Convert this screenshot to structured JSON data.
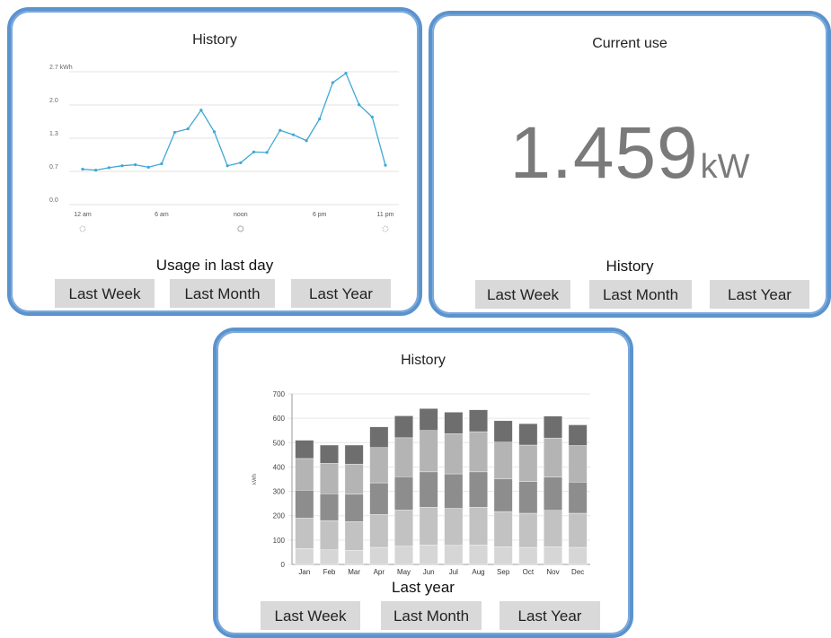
{
  "day_panel": {
    "title": "History",
    "subtitle": "Usage in last day",
    "buttons": [
      "Last Week",
      "Last Month",
      "Last Year"
    ]
  },
  "current_panel": {
    "title": "Current use",
    "value": "1.459",
    "unit": "kW",
    "subtitle": "History",
    "buttons": [
      "Last Week",
      "Last Month",
      "Last Year"
    ]
  },
  "year_panel": {
    "title": "History",
    "subtitle": "Last year",
    "buttons": [
      "Last Week",
      "Last Month",
      "Last Year"
    ]
  },
  "chart_data": [
    {
      "type": "line",
      "title": "History",
      "ylabel": "kWh",
      "yticks": [
        "0.0",
        "0.7",
        "1.3",
        "2.0",
        "2.7 kWh"
      ],
      "ylim": [
        0,
        2.7
      ],
      "xticks": [
        "12 am",
        "6 am",
        "noon",
        "6 pm",
        "11 pm"
      ],
      "xtick_hours": [
        0,
        6,
        12,
        18,
        23
      ],
      "x": [
        0,
        1,
        2,
        3,
        4,
        5,
        6,
        7,
        8,
        9,
        10,
        11,
        12,
        13,
        14,
        15,
        16,
        17,
        18,
        19,
        20,
        21,
        22,
        23
      ],
      "values": [
        0.72,
        0.7,
        0.75,
        0.79,
        0.81,
        0.76,
        0.83,
        1.47,
        1.54,
        1.92,
        1.48,
        0.79,
        0.85,
        1.07,
        1.06,
        1.51,
        1.42,
        1.3,
        1.74,
        2.48,
        2.67,
        2.03,
        1.78,
        0.8
      ],
      "line_color": "#3fa7d6",
      "grid": true
    },
    {
      "type": "bar",
      "stacked": true,
      "title": "History",
      "xlabel": "Last year",
      "ylabel": "kWh",
      "categories": [
        "Jan",
        "Feb",
        "Mar",
        "Apr",
        "May",
        "Jun",
        "Jul",
        "Aug",
        "Sep",
        "Oct",
        "Nov",
        "Dec"
      ],
      "ylim": [
        0,
        700
      ],
      "yticks": [
        0,
        100,
        200,
        300,
        400,
        500,
        600,
        700
      ],
      "series": [
        {
          "values": [
            65,
            60,
            58,
            70,
            75,
            80,
            78,
            80,
            72,
            70,
            72,
            70
          ],
          "color": "#d6d6d6"
        },
        {
          "values": [
            125,
            120,
            118,
            135,
            148,
            155,
            152,
            155,
            145,
            140,
            150,
            140
          ],
          "color": "#c2c2c2"
        },
        {
          "values": [
            115,
            110,
            112,
            130,
            137,
            145,
            142,
            145,
            135,
            130,
            137,
            128
          ],
          "color": "#8d8d8d"
        },
        {
          "values": [
            130,
            125,
            124,
            145,
            160,
            170,
            165,
            165,
            150,
            150,
            160,
            150
          ],
          "color": "#b4b4b4"
        },
        {
          "values": [
            75,
            75,
            78,
            85,
            90,
            90,
            88,
            90,
            88,
            88,
            90,
            85
          ],
          "color": "#6e6e6e"
        }
      ],
      "grid": true
    }
  ]
}
